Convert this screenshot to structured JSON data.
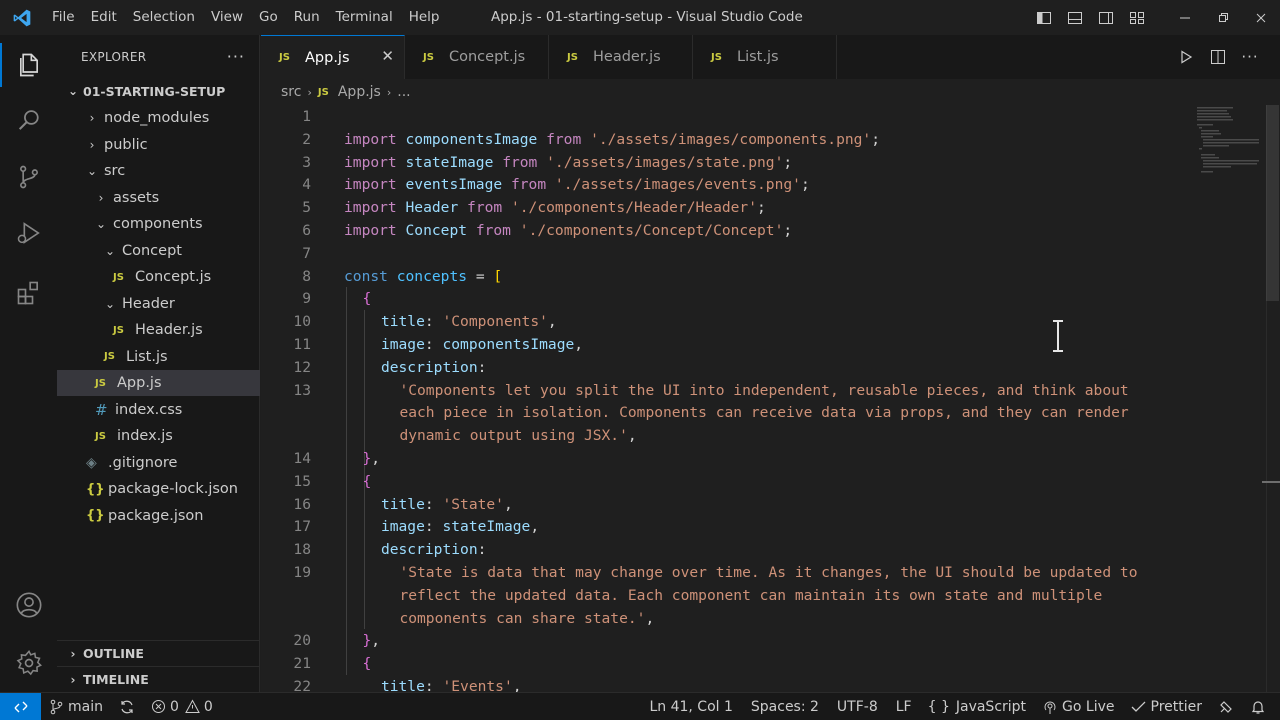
{
  "window": {
    "title": "App.js - 01-starting-setup - Visual Studio Code",
    "menu": [
      "File",
      "Edit",
      "Selection",
      "View",
      "Go",
      "Run",
      "Terminal",
      "Help"
    ]
  },
  "sidebar": {
    "header": "EXPLORER",
    "more": "···",
    "folder": "01-STARTING-SETUP",
    "tree": [
      {
        "label": "node_modules",
        "kind": "folder",
        "depth": 1,
        "expanded": false
      },
      {
        "label": "public",
        "kind": "folder",
        "depth": 1,
        "expanded": false
      },
      {
        "label": "src",
        "kind": "folder",
        "depth": 1,
        "expanded": true
      },
      {
        "label": "assets",
        "kind": "folder",
        "depth": 2,
        "expanded": false
      },
      {
        "label": "components",
        "kind": "folder",
        "depth": 2,
        "expanded": true
      },
      {
        "label": "Concept",
        "kind": "folder",
        "depth": 3,
        "expanded": true
      },
      {
        "label": "Concept.js",
        "kind": "js",
        "depth": 4
      },
      {
        "label": "Header",
        "kind": "folder",
        "depth": 3,
        "expanded": true
      },
      {
        "label": "Header.js",
        "kind": "js",
        "depth": 4
      },
      {
        "label": "List.js",
        "kind": "js",
        "depth": 3
      },
      {
        "label": "App.js",
        "kind": "js",
        "depth": 2,
        "selected": true
      },
      {
        "label": "index.css",
        "kind": "css",
        "depth": 2
      },
      {
        "label": "index.js",
        "kind": "js",
        "depth": 2
      },
      {
        "label": ".gitignore",
        "kind": "git",
        "depth": 1
      },
      {
        "label": "package-lock.json",
        "kind": "json",
        "depth": 1
      },
      {
        "label": "package.json",
        "kind": "json",
        "depth": 1
      }
    ],
    "sections": [
      "OUTLINE",
      "TIMELINE"
    ]
  },
  "tabs": [
    {
      "label": "App.js",
      "active": true
    },
    {
      "label": "Concept.js",
      "active": false
    },
    {
      "label": "Header.js",
      "active": false
    },
    {
      "label": "List.js",
      "active": false
    }
  ],
  "breadcrumb": {
    "folder": "src",
    "file": "App.js",
    "more": "..."
  },
  "icons": {
    "js_badge": "JS",
    "css_badge": "#",
    "json_badge": "{}",
    "git_badge": "◈"
  },
  "statusbar": {
    "branch": "main",
    "errors": "0",
    "warnings": "0",
    "position": "Ln 41, Col 1",
    "spaces": "Spaces: 2",
    "encoding": "UTF-8",
    "eol": "LF",
    "language": "JavaScript",
    "golive": "Go Live",
    "prettier": "Prettier"
  },
  "editor": {
    "lines": [
      {
        "n": "1",
        "indent": 0,
        "tokens": []
      },
      {
        "n": "2",
        "indent": 0,
        "tokens": [
          [
            "kw",
            "import"
          ],
          [
            "punc",
            " "
          ],
          [
            "var",
            "componentsImage"
          ],
          [
            "punc",
            " "
          ],
          [
            "kw",
            "from"
          ],
          [
            "punc",
            " "
          ],
          [
            "str",
            "'./assets/images/components.png'"
          ],
          [
            "punc",
            ";"
          ]
        ]
      },
      {
        "n": "3",
        "indent": 0,
        "tokens": [
          [
            "kw",
            "import"
          ],
          [
            "punc",
            " "
          ],
          [
            "var",
            "stateImage"
          ],
          [
            "punc",
            " "
          ],
          [
            "kw",
            "from"
          ],
          [
            "punc",
            " "
          ],
          [
            "str",
            "'./assets/images/state.png'"
          ],
          [
            "punc",
            ";"
          ]
        ]
      },
      {
        "n": "4",
        "indent": 0,
        "tokens": [
          [
            "kw",
            "import"
          ],
          [
            "punc",
            " "
          ],
          [
            "var",
            "eventsImage"
          ],
          [
            "punc",
            " "
          ],
          [
            "kw",
            "from"
          ],
          [
            "punc",
            " "
          ],
          [
            "str",
            "'./assets/images/events.png'"
          ],
          [
            "punc",
            ";"
          ]
        ]
      },
      {
        "n": "5",
        "indent": 0,
        "tokens": [
          [
            "kw",
            "import"
          ],
          [
            "punc",
            " "
          ],
          [
            "var",
            "Header"
          ],
          [
            "punc",
            " "
          ],
          [
            "kw",
            "from"
          ],
          [
            "punc",
            " "
          ],
          [
            "str",
            "'./components/Header/Header'"
          ],
          [
            "punc",
            ";"
          ]
        ]
      },
      {
        "n": "6",
        "indent": 0,
        "tokens": [
          [
            "kw",
            "import"
          ],
          [
            "punc",
            " "
          ],
          [
            "var",
            "Concept"
          ],
          [
            "punc",
            " "
          ],
          [
            "kw",
            "from"
          ],
          [
            "punc",
            " "
          ],
          [
            "str",
            "'./components/Concept/Concept'"
          ],
          [
            "punc",
            ";"
          ]
        ]
      },
      {
        "n": "7",
        "indent": 0,
        "tokens": []
      },
      {
        "n": "8",
        "indent": 0,
        "tokens": [
          [
            "const",
            "const"
          ],
          [
            "punc",
            " "
          ],
          [
            "cvar",
            "concepts"
          ],
          [
            "punc",
            " = "
          ],
          [
            "br1",
            "["
          ]
        ]
      },
      {
        "n": "9",
        "indent": 1,
        "tokens": [
          [
            "br2",
            "{"
          ]
        ]
      },
      {
        "n": "10",
        "indent": 2,
        "tokens": [
          [
            "prop",
            "title"
          ],
          [
            "punc",
            ": "
          ],
          [
            "str",
            "'Components'"
          ],
          [
            "punc",
            ","
          ]
        ]
      },
      {
        "n": "11",
        "indent": 2,
        "tokens": [
          [
            "prop",
            "image"
          ],
          [
            "punc",
            ": "
          ],
          [
            "var",
            "componentsImage"
          ],
          [
            "punc",
            ","
          ]
        ]
      },
      {
        "n": "12",
        "indent": 2,
        "tokens": [
          [
            "prop",
            "description"
          ],
          [
            "punc",
            ":"
          ]
        ]
      },
      {
        "n": "13",
        "indent": 3,
        "tokens": [
          [
            "str",
            "'Components let you split the UI into independent, reusable pieces, and think about"
          ]
        ]
      },
      {
        "n": "",
        "indent": 3,
        "tokens": [
          [
            "str",
            "each piece in isolation. Components can receive data via props, and they can render"
          ]
        ]
      },
      {
        "n": "",
        "indent": 3,
        "tokens": [
          [
            "str",
            "dynamic output using JSX.'"
          ],
          [
            "punc",
            ","
          ]
        ]
      },
      {
        "n": "14",
        "indent": 1,
        "tokens": [
          [
            "br2",
            "}"
          ],
          [
            "punc",
            ","
          ]
        ]
      },
      {
        "n": "15",
        "indent": 1,
        "tokens": [
          [
            "br2",
            "{"
          ]
        ]
      },
      {
        "n": "16",
        "indent": 2,
        "tokens": [
          [
            "prop",
            "title"
          ],
          [
            "punc",
            ": "
          ],
          [
            "str",
            "'State'"
          ],
          [
            "punc",
            ","
          ]
        ]
      },
      {
        "n": "17",
        "indent": 2,
        "tokens": [
          [
            "prop",
            "image"
          ],
          [
            "punc",
            ": "
          ],
          [
            "var",
            "stateImage"
          ],
          [
            "punc",
            ","
          ]
        ]
      },
      {
        "n": "18",
        "indent": 2,
        "tokens": [
          [
            "prop",
            "description"
          ],
          [
            "punc",
            ":"
          ]
        ]
      },
      {
        "n": "19",
        "indent": 3,
        "tokens": [
          [
            "str",
            "'State is data that may change over time. As it changes, the UI should be updated to"
          ]
        ]
      },
      {
        "n": "",
        "indent": 3,
        "tokens": [
          [
            "str",
            "reflect the updated data. Each component can maintain its own state and multiple"
          ]
        ]
      },
      {
        "n": "",
        "indent": 3,
        "tokens": [
          [
            "str",
            "components can share state.'"
          ],
          [
            "punc",
            ","
          ]
        ]
      },
      {
        "n": "20",
        "indent": 1,
        "tokens": [
          [
            "br2",
            "}"
          ],
          [
            "punc",
            ","
          ]
        ]
      },
      {
        "n": "21",
        "indent": 1,
        "tokens": [
          [
            "br2",
            "{"
          ]
        ]
      },
      {
        "n": "22",
        "indent": 2,
        "tokens": [
          [
            "prop",
            "title"
          ],
          [
            "punc",
            ": "
          ],
          [
            "str",
            "'Events'"
          ],
          [
            "punc",
            ","
          ]
        ]
      }
    ]
  }
}
